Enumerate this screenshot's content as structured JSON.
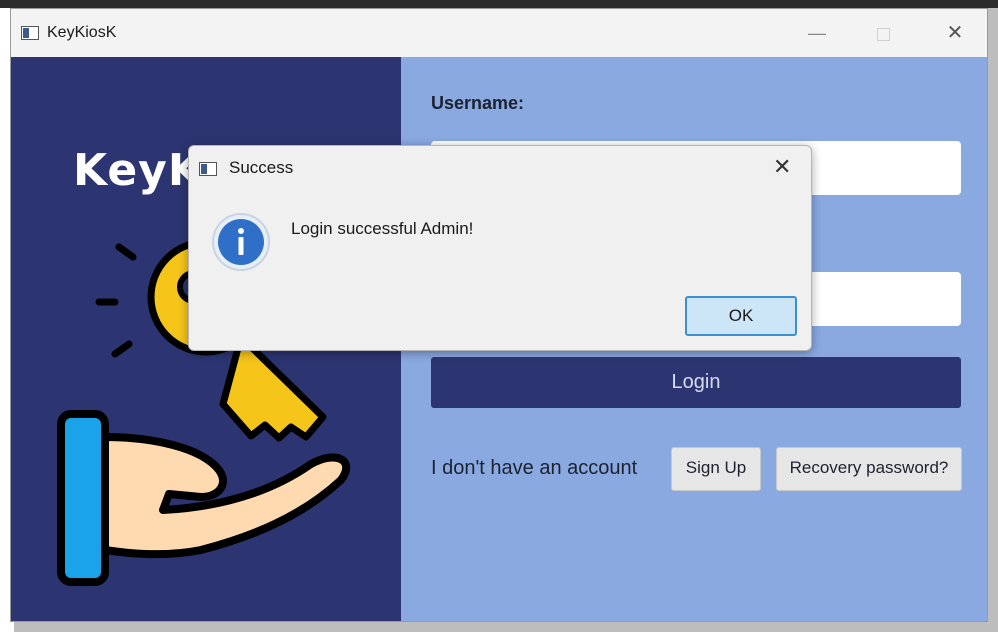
{
  "window": {
    "title": "KeyKiosK",
    "controls": {
      "minimize": "—",
      "close": "✕"
    }
  },
  "left_panel": {
    "brand_text": "KeyKiosK",
    "illustration": "key-in-hand-icon"
  },
  "form": {
    "username_label": "Username:",
    "username_value": "",
    "password_value": "",
    "login_label": "Login",
    "no_account_text": "I don't have an account",
    "signup_label": "Sign Up",
    "recovery_label": "Recovery password?"
  },
  "dialog": {
    "title": "Success",
    "message": "Login successful Admin!",
    "ok_label": "OK",
    "close_symbol": "✕",
    "icon": "info-icon"
  },
  "colors": {
    "left_bg": "#2c3571",
    "right_bg": "#8aa9e1",
    "login_button_bg": "#2c3571",
    "key_yellow": "#f5c51a",
    "info_blue": "#2f6fc8"
  }
}
